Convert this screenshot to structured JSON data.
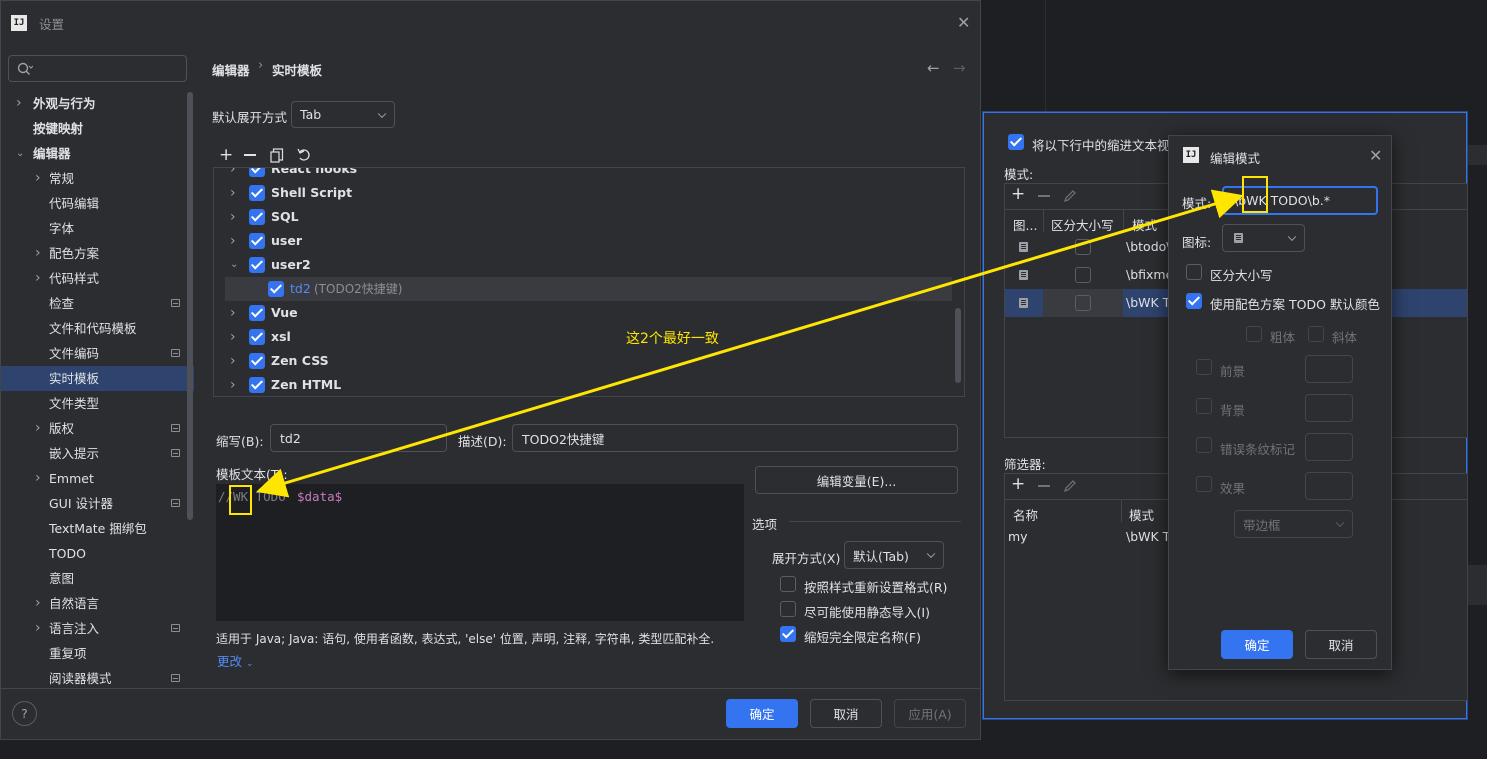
{
  "main_dialog": {
    "title": "设置",
    "search": {
      "placeholder": "Q▾"
    },
    "breadcrumb": [
      "编辑器",
      "实时模板"
    ],
    "sidebar": [
      {
        "label": "外观与行为",
        "bold": true,
        "expandable": true
      },
      {
        "label": "按键映射",
        "bold": true
      },
      {
        "label": "编辑器",
        "bold": true,
        "expanded": true
      },
      {
        "label": "常规",
        "expandable": true
      },
      {
        "label": "代码编辑"
      },
      {
        "label": "字体"
      },
      {
        "label": "配色方案",
        "expandable": true
      },
      {
        "label": "代码样式",
        "expandable": true
      },
      {
        "label": "检查",
        "project": true
      },
      {
        "label": "文件和代码模板"
      },
      {
        "label": "文件编码",
        "project": true
      },
      {
        "label": "实时模板",
        "selected": true
      },
      {
        "label": "文件类型"
      },
      {
        "label": "版权",
        "expandable": true,
        "project": true
      },
      {
        "label": "嵌入提示",
        "project": true
      },
      {
        "label": "Emmet",
        "expandable": true
      },
      {
        "label": "GUI 设计器",
        "project": true
      },
      {
        "label": "TextMate 捆绑包"
      },
      {
        "label": "TODO"
      },
      {
        "label": "意图"
      },
      {
        "label": "自然语言",
        "expandable": true
      },
      {
        "label": "语言注入",
        "expandable": true,
        "project": true
      },
      {
        "label": "重复项"
      },
      {
        "label": "阅读器模式",
        "project": true
      }
    ],
    "expand_label": "默认展开方式",
    "expand_value": "Tab",
    "tree": [
      {
        "label": "React hooks",
        "checked": true,
        "partial": true
      },
      {
        "label": "Shell Script",
        "checked": true
      },
      {
        "label": "SQL",
        "checked": true
      },
      {
        "label": "user",
        "checked": true
      },
      {
        "label": "user2",
        "checked": true,
        "expanded": true
      },
      {
        "label": "td2",
        "desc": "(TODO2快捷键)",
        "checked": true,
        "child": true,
        "selected": true
      },
      {
        "label": "Vue",
        "checked": true
      },
      {
        "label": "xsl",
        "checked": true
      },
      {
        "label": "Zen CSS",
        "checked": true
      },
      {
        "label": "Zen HTML",
        "checked": true
      }
    ],
    "abbr_label": "缩写(B):",
    "abbr_value": "td2",
    "desc_label": "描述(D):",
    "desc_value": "TODO2快捷键",
    "template_label": "模板文本(T):",
    "template_code": {
      "comment": "//WK TODO ",
      "var": "$data$"
    },
    "edit_vars": "编辑变量(E)...",
    "options_title": "选项",
    "expand_with_label": "展开方式(X)",
    "expand_with_value": "默认(Tab)",
    "options": [
      {
        "label": "按照样式重新设置格式(R)",
        "checked": false
      },
      {
        "label": "尽可能使用静态导入(I)",
        "checked": false
      },
      {
        "label": "缩短完全限定名称(F)",
        "checked": true
      }
    ],
    "applicable": "适用于 Java; Java: 语句, 使用者函数, 表达式, 'else' 位置, 声明, 注释, 字符串, 类型匹配补全.",
    "change": "更改",
    "ok": "确定",
    "cancel": "取消",
    "apply": "应用(A)",
    "help": "?"
  },
  "annotation": {
    "text": "这2个最好一致",
    "color": "#ffe600"
  },
  "right_dialog": {
    "checkbox_label": "将以下行中的缩进文本视为",
    "patterns_label": "模式:",
    "columns": [
      "图...",
      "区分大小写",
      "模式"
    ],
    "rows": [
      {
        "pattern": "\\btodo\\"
      },
      {
        "pattern": "\\bfixme"
      },
      {
        "pattern": "\\bWK T",
        "selected": true
      }
    ],
    "filters_label": "筛选器:",
    "filter_columns": [
      "名称",
      "模式"
    ],
    "filter_rows": [
      {
        "name": "my",
        "pattern": "\\bWK T"
      }
    ]
  },
  "edit_pattern_dialog": {
    "title": "编辑模式",
    "pattern_label": "模式:",
    "pattern_value": "\\bWK TODO\\b.*",
    "icon_label": "图标:",
    "case_label": "区分大小写",
    "use_color_label": "使用配色方案 TODO 默认颜色",
    "bold": "粗体",
    "italic": "斜体",
    "foreground": "前景",
    "background": "背景",
    "error_stripe": "错误条纹标记",
    "effects": "效果",
    "effect_type": "带边框",
    "ok": "确定",
    "cancel": "取消"
  }
}
